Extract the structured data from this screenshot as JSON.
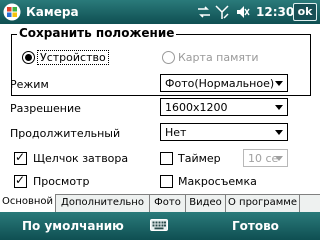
{
  "titlebar": {
    "title": "Камера",
    "time": "12:30",
    "ok_label": "ok",
    "icons": [
      "windows-logo",
      "sync-icon",
      "signal-icon",
      "no-sound-icon"
    ]
  },
  "location": {
    "title": "Сохранить положение",
    "option_device": "Устройство",
    "option_card": "Карта памяти",
    "selected": "Устройство"
  },
  "settings": {
    "mode_label": "Режим",
    "mode_value": "Фото(Нормальное)",
    "resolution_label": "Разрешение",
    "resolution_value": "1600x1200",
    "duration_label": "Продолжительный",
    "duration_value": "Нет"
  },
  "checks": {
    "shutter_label": "Щелчок затвора",
    "shutter_checked": true,
    "timer_label": "Таймер",
    "timer_checked": false,
    "timer_value": "10 се",
    "preview_label": "Просмотр",
    "preview_checked": true,
    "macro_label": "Макросъемка",
    "macro_checked": false
  },
  "tabs": [
    "Основной",
    "Дополнительно",
    "Фото",
    "Видео",
    "О программе"
  ],
  "active_tab": "Основной",
  "softkeys": {
    "left": "По умолчанию",
    "right": "Готово"
  },
  "colors": {
    "bar_top": "#2a7a7a",
    "bar_bottom": "#0f4f52"
  }
}
